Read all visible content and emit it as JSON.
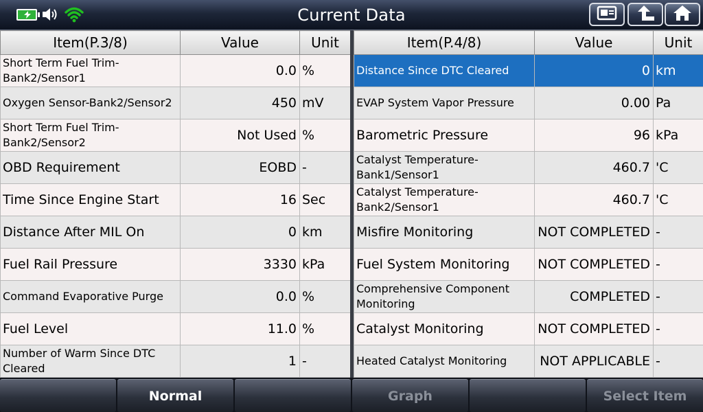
{
  "header": {
    "title": "Current Data",
    "battery_color": "#2fb23a",
    "wifi_color": "#20c020"
  },
  "left_table": {
    "col_item": "Item(P.3/8)",
    "col_value": "Value",
    "col_unit": "Unit",
    "rows": [
      {
        "name": "Short Term Fuel Trim-Bank2/Sensor1",
        "value": "0.0",
        "unit": "%"
      },
      {
        "name": "Oxygen Sensor-Bank2/Sensor2",
        "value": "450",
        "unit": "mV"
      },
      {
        "name": "Short Term Fuel Trim-Bank2/Sensor2",
        "value": "Not Used",
        "unit": "%"
      },
      {
        "name": "OBD Requirement",
        "value": "EOBD",
        "unit": "-"
      },
      {
        "name": "Time Since Engine Start",
        "value": "16",
        "unit": "Sec"
      },
      {
        "name": "Distance After MIL On",
        "value": "0",
        "unit": "km"
      },
      {
        "name": "Fuel Rail Pressure",
        "value": "3330",
        "unit": "kPa"
      },
      {
        "name": "Command Evaporative Purge",
        "value": "0.0",
        "unit": "%"
      },
      {
        "name": "Fuel Level",
        "value": "11.0",
        "unit": "%"
      },
      {
        "name": "Number of Warm Since DTC Cleared",
        "value": "1",
        "unit": "-"
      }
    ]
  },
  "right_table": {
    "col_item": "Item(P.4/8)",
    "col_value": "Value",
    "col_unit": "Unit",
    "rows": [
      {
        "name": "Distance Since DTC Cleared",
        "value": "0",
        "unit": "km"
      },
      {
        "name": "EVAP System Vapor Pressure",
        "value": "0.00",
        "unit": "Pa"
      },
      {
        "name": "Barometric Pressure",
        "value": "96",
        "unit": "kPa"
      },
      {
        "name": "Catalyst Temperature-Bank1/Sensor1",
        "value": "460.7",
        "unit": "'C"
      },
      {
        "name": "Catalyst Temperature-Bank2/Sensor1",
        "value": "460.7",
        "unit": "'C"
      },
      {
        "name": "Misfire Monitoring",
        "value": "NOT COMPLETED",
        "unit": "-"
      },
      {
        "name": "Fuel System Monitoring",
        "value": "NOT COMPLETED",
        "unit": "-"
      },
      {
        "name": "Comprehensive Component Monitoring",
        "value": "COMPLETED",
        "unit": "-"
      },
      {
        "name": "Catalyst Monitoring",
        "value": "NOT COMPLETED",
        "unit": "-"
      },
      {
        "name": "Heated Catalyst Monitoring",
        "value": "NOT APPLICABLE",
        "unit": "-"
      }
    ]
  },
  "footer": {
    "buttons": [
      "",
      "Normal",
      "",
      "Graph",
      "",
      "Select Item"
    ]
  },
  "selection_color": "#1d6fc0"
}
